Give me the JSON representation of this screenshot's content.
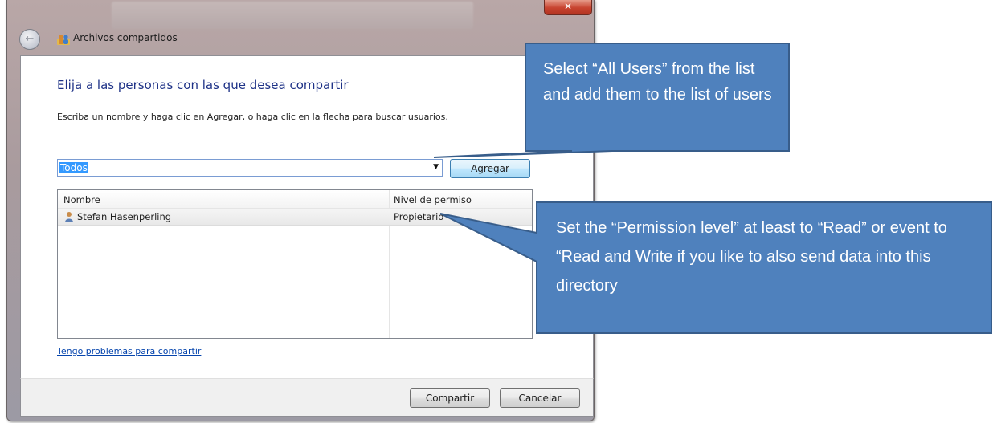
{
  "window": {
    "address_title": "Archivos compartidos",
    "close_glyph": "✕",
    "back_glyph": "←"
  },
  "dialog": {
    "heading": "Elija a las personas con las que desea compartir",
    "instruction": "Escriba un nombre y haga clic en Agregar, o haga clic en la flecha para buscar usuarios.",
    "combo_value": "Todos",
    "combo_arrow": "▼",
    "add_button": "Agregar",
    "columns": [
      "Nombre",
      "Nivel de permiso"
    ],
    "rows": [
      {
        "name": "Stefan Hasenperling",
        "permission": "Propietario"
      }
    ],
    "trouble_link": "Tengo problemas para compartir",
    "share_button": "Compartir",
    "cancel_button": "Cancelar"
  },
  "callouts": [
    {
      "text": "Select “All Users” from the list and add them to the list of users"
    },
    {
      "text": "Set the “Permission level” at least to “Read” or event to “Read and Write if you like to also send data into this directory"
    }
  ],
  "colors": {
    "callout_fill": "#4f81bd",
    "callout_border": "#385d8a",
    "heading": "#1e3287",
    "link": "#0645ad",
    "selection": "#3399ff"
  }
}
